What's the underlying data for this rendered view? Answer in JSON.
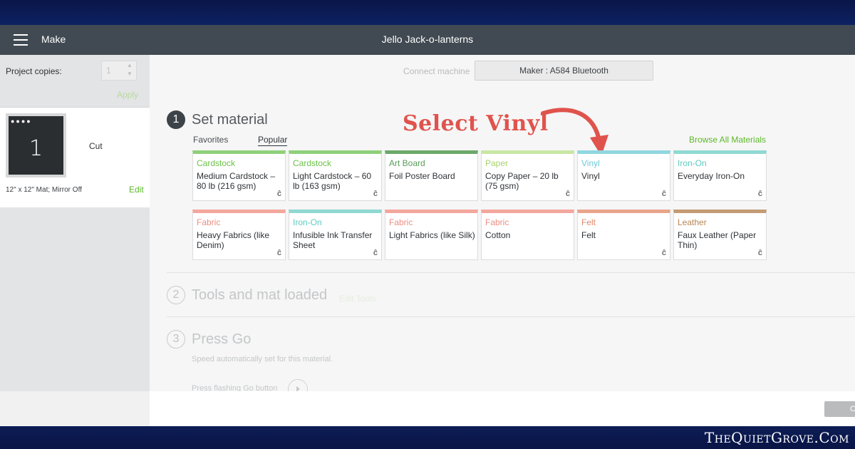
{
  "header": {
    "menu_icon": "hamburger-icon",
    "mode": "Make",
    "project_title": "Jello Jack-o-lanterns"
  },
  "sidebar": {
    "copies_label": "Project copies:",
    "copies_value": "1",
    "apply_label": "Apply",
    "mat_number": "1",
    "mat_operation": "Cut",
    "mat_info": "12\" x 12\" Mat; Mirror Off",
    "edit_label": "Edit"
  },
  "main": {
    "connect_label": "Connect machine",
    "machine_name": "Maker : A584 Bluetooth",
    "step1": {
      "number": "1",
      "title": "Set material"
    },
    "tabs": {
      "favorites": "Favorites",
      "popular": "Popular"
    },
    "browse_label": "Browse All Materials",
    "annotation": "Select Vinyl",
    "materials": [
      {
        "category": "Cardstock",
        "name": "Medium Cardstock – 80 lb (216 gsm)",
        "color": "#8fd17c",
        "cat_color": "#6cc24a"
      },
      {
        "category": "Cardstock",
        "name": "Light Cardstock – 60 lb (163 gsm)",
        "color": "#8fd17c",
        "cat_color": "#6cc24a"
      },
      {
        "category": "Art Board",
        "name": "Foil Poster Board",
        "color": "#6ca96a",
        "cat_color": "#5a9c57"
      },
      {
        "category": "Paper",
        "name": "Copy Paper – 20 lb (75 gsm)",
        "color": "#c9e7a3",
        "cat_color": "#a9d36f"
      },
      {
        "category": "Vinyl",
        "name": "Vinyl",
        "color": "#8fd6e0",
        "cat_color": "#6ccad6"
      },
      {
        "category": "Iron-On",
        "name": "Everyday Iron-On",
        "color": "#8fd9d2",
        "cat_color": "#5fcac0"
      },
      {
        "category": "Fabric",
        "name": "Heavy Fabrics (like Denim)",
        "color": "#f4a79d",
        "cat_color": "#ee8d80"
      },
      {
        "category": "Iron-On",
        "name": "Infusible Ink Transfer Sheet",
        "color": "#8fd9d2",
        "cat_color": "#5fcac0"
      },
      {
        "category": "Fabric",
        "name": "Light Fabrics (like Silk)",
        "color": "#f4a79d",
        "cat_color": "#ee8d80"
      },
      {
        "category": "Fabric",
        "name": "Cotton",
        "color": "#f4a79d",
        "cat_color": "#ee8d80"
      },
      {
        "category": "Felt",
        "name": "Felt",
        "color": "#e9a58b",
        "cat_color": "#e08a6b"
      },
      {
        "category": "Leather",
        "name": "Faux Leather (Paper Thin)",
        "color": "#c39b74",
        "cat_color": "#b88656"
      }
    ],
    "step2": {
      "number": "2",
      "title": "Tools and mat loaded",
      "edit_tools": "Edit Tools"
    },
    "step3": {
      "number": "3",
      "title": "Press Go",
      "speed_note": "Speed automatically set for this material.",
      "press_note": "Press flashing Go button"
    }
  },
  "footer": {
    "cancel_label": "C"
  },
  "watermark": "TheQuietGrove.Com",
  "colors": {
    "accent_green": "#5cb829",
    "header_bg": "#414a52",
    "annotation_red": "#e0534d"
  }
}
